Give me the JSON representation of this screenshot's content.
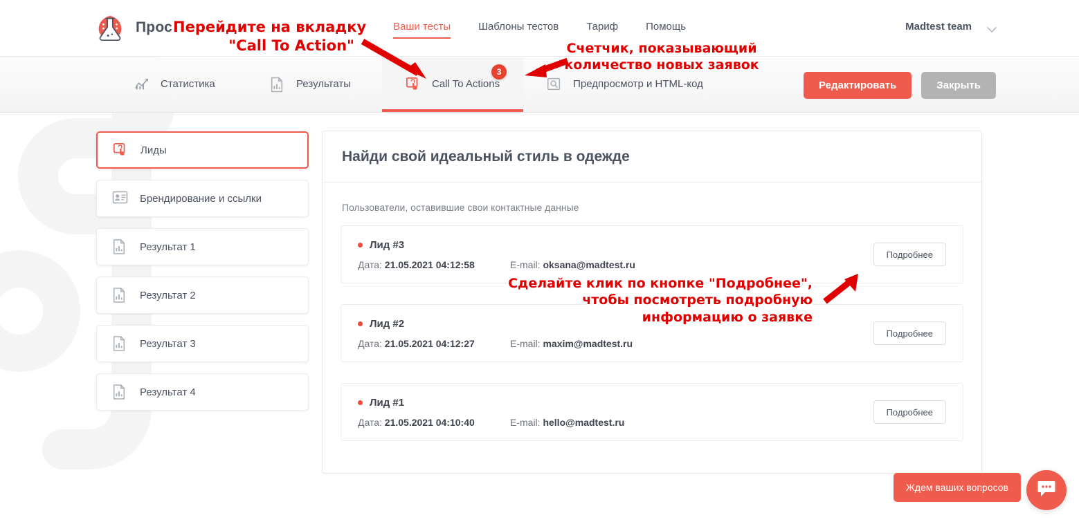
{
  "header": {
    "logo_icon": "flask-logo-icon",
    "brand": "Прос",
    "nav": [
      {
        "label": "Ваши тесты",
        "active": true
      },
      {
        "label": "Шаблоны тестов",
        "active": false
      },
      {
        "label": "Тариф",
        "active": false
      },
      {
        "label": "Помощь",
        "active": false
      }
    ],
    "user": {
      "name": "Madtest team",
      "chevron_icon": "chevron-down-icon"
    }
  },
  "tabbar": {
    "tabs": [
      {
        "label": "Статистика",
        "icon": "chart-line-icon",
        "active": false,
        "badge": ""
      },
      {
        "label": "Результаты",
        "icon": "document-chart-icon",
        "active": false,
        "badge": ""
      },
      {
        "label": "Call To Actions",
        "icon": "cursor-click-icon",
        "active": true,
        "badge": "3"
      },
      {
        "label": "Предпросмотр и HTML-код",
        "icon": "magnifier-box-icon",
        "active": false,
        "badge": ""
      }
    ],
    "edit_button": "Редактировать",
    "close_button": "Закрыть"
  },
  "sidebar": {
    "items": [
      {
        "label": "Лиды",
        "icon": "cursor-click-icon",
        "active": true
      },
      {
        "label": "Брендирование и ссылки",
        "icon": "id-card-icon",
        "active": false
      },
      {
        "label": "Результат 1",
        "icon": "document-chart-icon",
        "active": false
      },
      {
        "label": "Результат 2",
        "icon": "document-chart-icon",
        "active": false
      },
      {
        "label": "Результат 3",
        "icon": "document-chart-icon",
        "active": false
      },
      {
        "label": "Результат 4",
        "icon": "document-chart-icon",
        "active": false
      }
    ]
  },
  "panel": {
    "title": "Найди свой идеальный стиль в одежде",
    "subtitle": "Пользователи, оставившие свои контактные данные",
    "date_label": "Дата:",
    "email_label": "E-mail:",
    "detail_button": "Подробнее",
    "leads": [
      {
        "title": "Лид #3",
        "date": "21.05.2021 04:12:58",
        "email": "oksana@madtest.ru"
      },
      {
        "title": "Лид #2",
        "date": "21.05.2021 04:12:27",
        "email": "maxim@madtest.ru"
      },
      {
        "title": "Лид #1",
        "date": "21.05.2021 04:10:40",
        "email": "hello@madtest.ru"
      }
    ]
  },
  "chat": {
    "label": "Ждем ваших вопросов",
    "bubble_icon": "chat-bubble-icon"
  },
  "annotations": [
    {
      "id": "anno1",
      "text": "Перейдите на вкладку\n\"Call To Action\""
    },
    {
      "id": "anno2",
      "text": "Счетчик, показывающий\nколичество новых заявок"
    },
    {
      "id": "anno3",
      "text": "Сделайте клик по кнопке \"Подробнее\",\nчтобы посмотреть подробную\nинформацию о заявке"
    }
  ],
  "colors": {
    "accent": "#ef5b4c",
    "badge": "#e8412e",
    "annotation": "#e00000",
    "text": "#4c5360",
    "secondary_button": "#b3b3b3"
  }
}
